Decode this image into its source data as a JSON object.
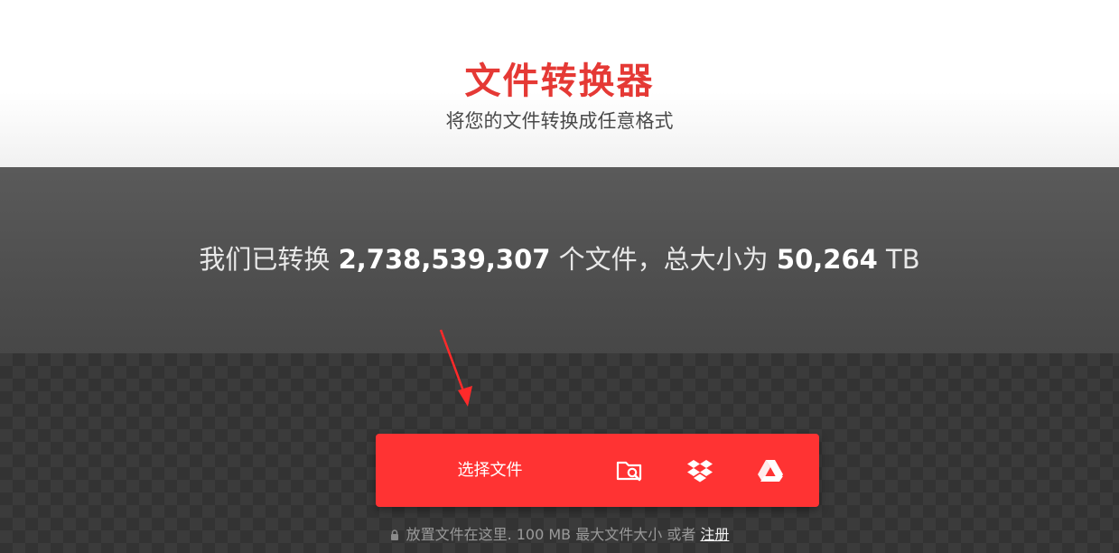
{
  "header": {
    "title": "文件转换器",
    "subtitle": "将您的文件转换成任意格式"
  },
  "stats": {
    "prefix": "我们已转换",
    "file_count": "2,738,539,307",
    "middle": "个文件，总大小为",
    "total_size": "50,264",
    "unit": "TB"
  },
  "upload": {
    "choose_label": "选择文件",
    "icons": [
      "folder-search-icon",
      "dropbox-icon",
      "google-drive-icon"
    ]
  },
  "footnote": {
    "text": "放置文件在这里. 100 MB 最大文件大小 或者",
    "link_label": "注册"
  },
  "colors": {
    "accent": "#ff3333",
    "title": "#e53935",
    "band": "#505050"
  }
}
